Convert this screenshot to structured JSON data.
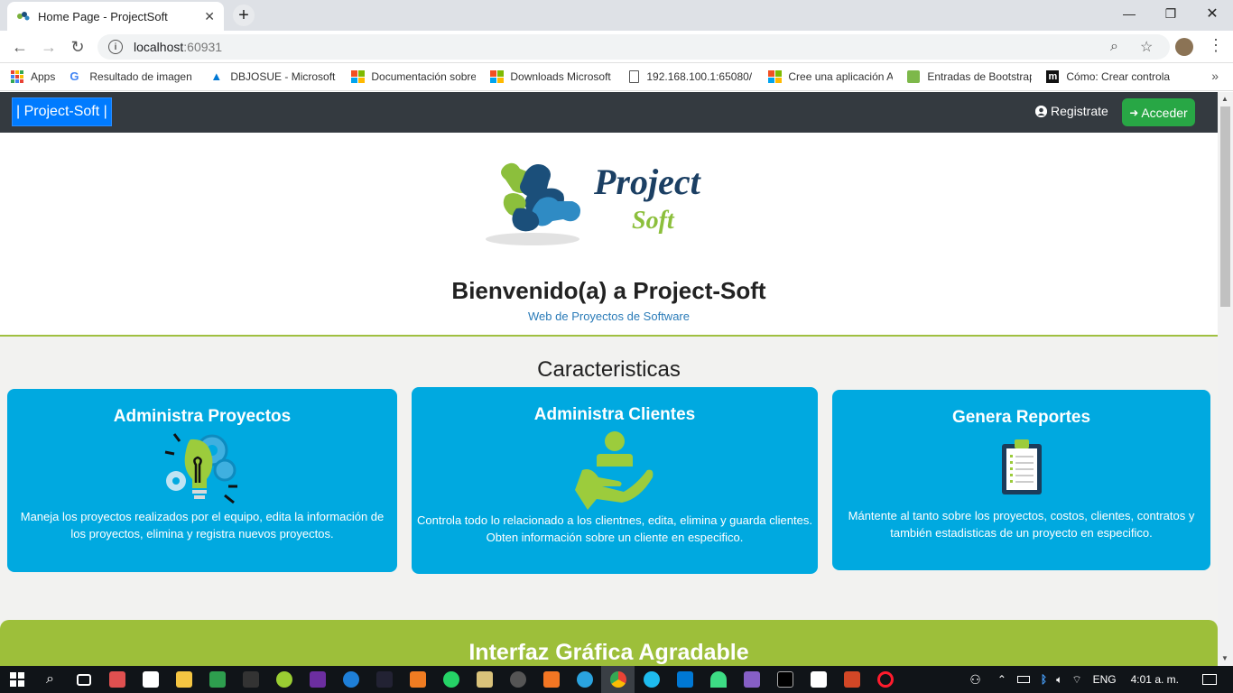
{
  "browser": {
    "tab_title": "Home Page - ProjectSoft",
    "url_host": "localhost",
    "url_port": ":60931",
    "bookmarks": [
      {
        "label": "Apps"
      },
      {
        "label": "Resultado de imagen"
      },
      {
        "label": "DBJOSUE - Microsoft"
      },
      {
        "label": "Documentación sobre"
      },
      {
        "label": "Downloads Microsoft"
      },
      {
        "label": "192.168.100.1:65080/"
      },
      {
        "label": "Cree una aplicación A"
      },
      {
        "label": "Entradas de Bootstrap"
      },
      {
        "label": "Cómo: Crear controla"
      }
    ]
  },
  "nav": {
    "brand": "| Project-Soft |",
    "register": "Registrate",
    "login": "Acceder"
  },
  "hero": {
    "logo_word1": "Project",
    "logo_word2": "Soft",
    "title": "Bienvenido(a) a Project-Soft",
    "subtitle": "Web de Proyectos de Software"
  },
  "features": {
    "title": "Caracteristicas",
    "cards": [
      {
        "title": "Administra Proyectos",
        "text": "Maneja los proyectos realizados por el equipo, edita la información de los proyectos, elimina y registra nuevos proyectos.",
        "icon": "lightbulb-gears-icon"
      },
      {
        "title": "Administra Clientes",
        "text": "Controla todo lo relacionado a los clientnes, edita, elimina y guarda clientes. Obten información sobre un cliente en especifico.",
        "icon": "client-hand-icon"
      },
      {
        "title": "Genera Reportes",
        "text": "Mántente al tanto sobre los proyectos, costos, clientes, contratos y también estadisticas de un proyecto en especifico.",
        "icon": "clipboard-icon"
      }
    ]
  },
  "section2": {
    "title": "Interfaz Gráfica Agradable"
  },
  "taskbar": {
    "lang": "ENG",
    "time": "4:01 a. m."
  },
  "colors": {
    "navbar": "#343a40",
    "card": "#00a9e0",
    "accent_green": "#9dbf3a",
    "brand_blue": "#007bff",
    "success": "#28a745"
  }
}
